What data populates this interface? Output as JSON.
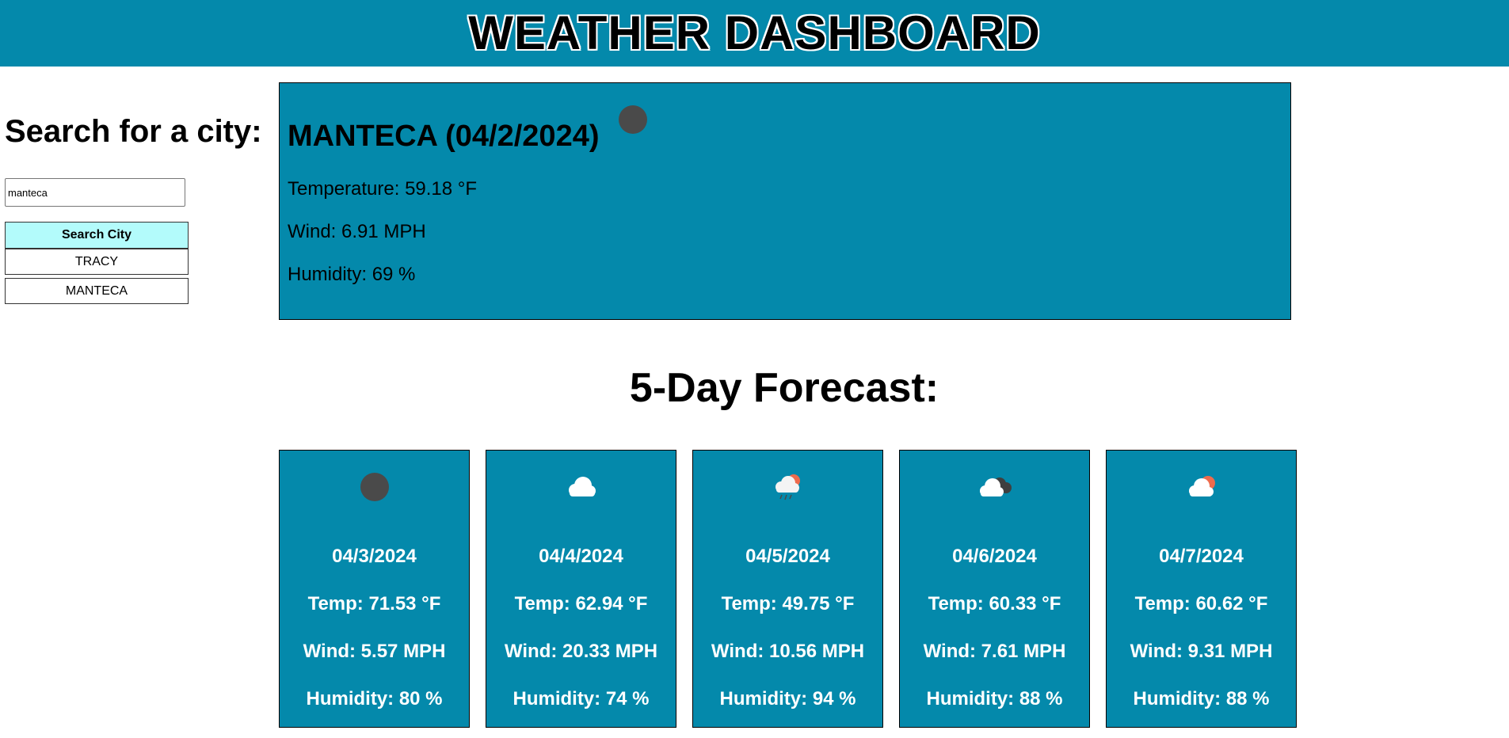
{
  "header": {
    "title": "WEATHER DASHBOARD"
  },
  "search": {
    "heading": "Search for a city:",
    "input_value": "manteca",
    "button_label": "Search City",
    "history": [
      "TRACY",
      "MANTECA"
    ]
  },
  "current": {
    "city_date": "MANTECA (04/2/2024)",
    "icon": "dark-circle-icon",
    "temperature": "Temperature: 59.18 °F",
    "wind": "Wind: 6.91 MPH",
    "humidity": "Humidity: 69 %"
  },
  "forecast": {
    "title": "5-Day Forecast:",
    "days": [
      {
        "icon": "dark-circle-icon",
        "date": "04/3/2024",
        "temp": "Temp: 71.53 °F",
        "wind": "Wind: 5.57 MPH",
        "humidity": "Humidity: 80 %"
      },
      {
        "icon": "cloud-icon",
        "date": "04/4/2024",
        "temp": "Temp: 62.94 °F",
        "wind": "Wind: 20.33 MPH",
        "humidity": "Humidity: 74 %"
      },
      {
        "icon": "sun-rain-cloud-icon",
        "date": "04/5/2024",
        "temp": "Temp: 49.75 °F",
        "wind": "Wind: 10.56 MPH",
        "humidity": "Humidity: 94 %"
      },
      {
        "icon": "dark-clouds-icon",
        "date": "04/6/2024",
        "temp": "Temp: 60.33 °F",
        "wind": "Wind: 7.61 MPH",
        "humidity": "Humidity: 88 %"
      },
      {
        "icon": "sun-cloud-icon",
        "date": "04/7/2024",
        "temp": "Temp: 60.62 °F",
        "wind": "Wind: 9.31 MPH",
        "humidity": "Humidity: 88 %"
      }
    ]
  },
  "colors": {
    "panel": "#0489ab",
    "search_button": "#b3fbfb",
    "icon_dark": "#4a4a4a",
    "sun": "#ee6b4d"
  }
}
